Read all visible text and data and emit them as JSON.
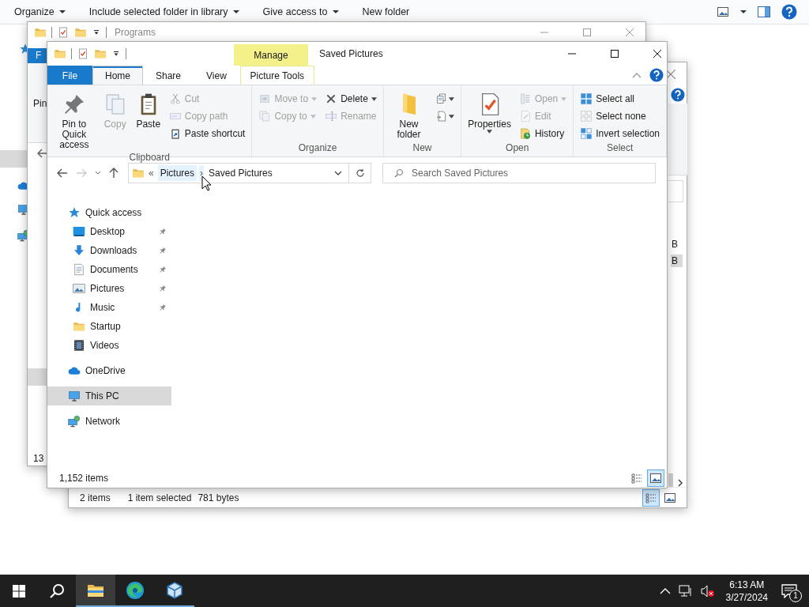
{
  "desktop_window": {
    "toolbar": [
      {
        "label": "Organize",
        "has_menu": true
      },
      {
        "label": "Include selected folder in library",
        "has_menu": true
      },
      {
        "label": "Give access to",
        "has_menu": true
      },
      {
        "label": "New folder",
        "has_menu": false
      }
    ]
  },
  "programs_window": {
    "title": "Programs",
    "file_tab": "F",
    "ribbon_fragment": "Pin",
    "status_fragment": "13"
  },
  "second_window": {
    "size_fragments": [
      {
        "text": "B",
        "selected": false
      },
      {
        "text": "B",
        "selected": true
      }
    ],
    "status": {
      "count": "2 items",
      "selection": "1 item selected",
      "size": "781 bytes"
    },
    "views": [
      {
        "kind": "details",
        "selected": true
      },
      {
        "kind": "large_icons",
        "selected": false
      }
    ]
  },
  "main_window": {
    "title": "Saved Pictures",
    "context_tab": {
      "header": "Manage"
    },
    "tabs": [
      {
        "label": "File",
        "kind": "file",
        "selected": false
      },
      {
        "label": "Home",
        "kind": "tab",
        "selected": true
      },
      {
        "label": "Share",
        "kind": "tab",
        "selected": false
      },
      {
        "label": "View",
        "kind": "tab",
        "selected": false
      },
      {
        "label": "Picture Tools",
        "kind": "context",
        "selected": false
      }
    ],
    "ribbon": [
      {
        "label": "Clipboard",
        "columns": [
          [
            {
              "label": "Pin to Quick access",
              "kind": "large",
              "disabled": false,
              "dropdown": false
            }
          ],
          [
            {
              "label": "Copy",
              "kind": "large",
              "disabled": true,
              "dropdown": false
            }
          ],
          [
            {
              "label": "Paste",
              "kind": "large",
              "disabled": false,
              "dropdown": false
            }
          ],
          [
            {
              "label": "Cut",
              "kind": "small",
              "disabled": true,
              "dropdown": false
            },
            {
              "label": "Copy path",
              "kind": "small",
              "disabled": true,
              "dropdown": false
            },
            {
              "label": "Paste shortcut",
              "kind": "small",
              "disabled": false,
              "dropdown": false
            }
          ]
        ]
      },
      {
        "label": "Organize",
        "columns": [
          [
            {
              "label": "Move to",
              "kind": "small",
              "disabled": true,
              "dropdown": true
            },
            {
              "label": "Copy to",
              "kind": "small",
              "disabled": true,
              "dropdown": true
            }
          ],
          [
            {
              "label": "Delete",
              "kind": "small",
              "disabled": false,
              "dropdown": true
            },
            {
              "label": "Rename",
              "kind": "small",
              "disabled": true,
              "dropdown": false
            }
          ]
        ]
      },
      {
        "label": "New",
        "columns": [
          [
            {
              "label": "New folder",
              "kind": "large",
              "disabled": false,
              "dropdown": false
            }
          ],
          [
            {
              "kind": "icon",
              "disabled": false,
              "dropdown": true
            },
            {
              "kind": "icon",
              "disabled": false,
              "dropdown": true
            }
          ]
        ]
      },
      {
        "label": "Open",
        "columns": [
          [
            {
              "label": "Properties",
              "kind": "large",
              "disabled": false,
              "dropdown": true
            }
          ],
          [
            {
              "label": "Open",
              "kind": "small",
              "disabled": true,
              "dropdown": true
            },
            {
              "label": "Edit",
              "kind": "small",
              "disabled": true,
              "dropdown": false
            },
            {
              "label": "History",
              "kind": "small",
              "disabled": false,
              "dropdown": false
            }
          ]
        ]
      },
      {
        "label": "Select",
        "columns": [
          [
            {
              "label": "Select all",
              "kind": "small",
              "disabled": false,
              "dropdown": false
            },
            {
              "label": "Select none",
              "kind": "small",
              "disabled": false,
              "dropdown": false
            },
            {
              "label": "Invert selection",
              "kind": "small",
              "disabled": false,
              "dropdown": false
            }
          ]
        ]
      }
    ],
    "address": {
      "overflow": "«",
      "separator": "›",
      "segments": [
        {
          "label": "Pictures",
          "hovered": true
        },
        {
          "label": "Saved Pictures",
          "hovered": false
        }
      ]
    },
    "search": {
      "placeholder": "Search Saved Pictures"
    },
    "navigation": [
      {
        "label": "Quick access",
        "selected": false,
        "children": [
          {
            "label": "Desktop",
            "pinned": true,
            "selected": false
          },
          {
            "label": "Downloads",
            "pinned": true,
            "selected": false
          },
          {
            "label": "Documents",
            "pinned": true,
            "selected": false
          },
          {
            "label": "Pictures",
            "pinned": true,
            "selected": false
          },
          {
            "label": "Music",
            "pinned": true,
            "selected": false
          },
          {
            "label": "Startup",
            "pinned": false,
            "selected": false
          },
          {
            "label": "Videos",
            "pinned": false,
            "selected": false
          }
        ]
      },
      {
        "label": "OneDrive",
        "selected": false
      },
      {
        "label": "This PC",
        "selected": true
      },
      {
        "label": "Network",
        "selected": false
      }
    ],
    "status": {
      "count": "1,152 items"
    },
    "views": [
      {
        "kind": "details",
        "selected": false
      },
      {
        "kind": "large_icons",
        "selected": true
      }
    ]
  },
  "taskbar": {
    "apps": [
      {
        "kind": "explorer",
        "active": true,
        "running": true
      },
      {
        "kind": "edge",
        "active": false,
        "running": true
      },
      {
        "kind": "cube",
        "active": false,
        "running": true
      }
    ],
    "time": "6:13 AM",
    "date": "3/27/2024",
    "notifications": "1"
  }
}
